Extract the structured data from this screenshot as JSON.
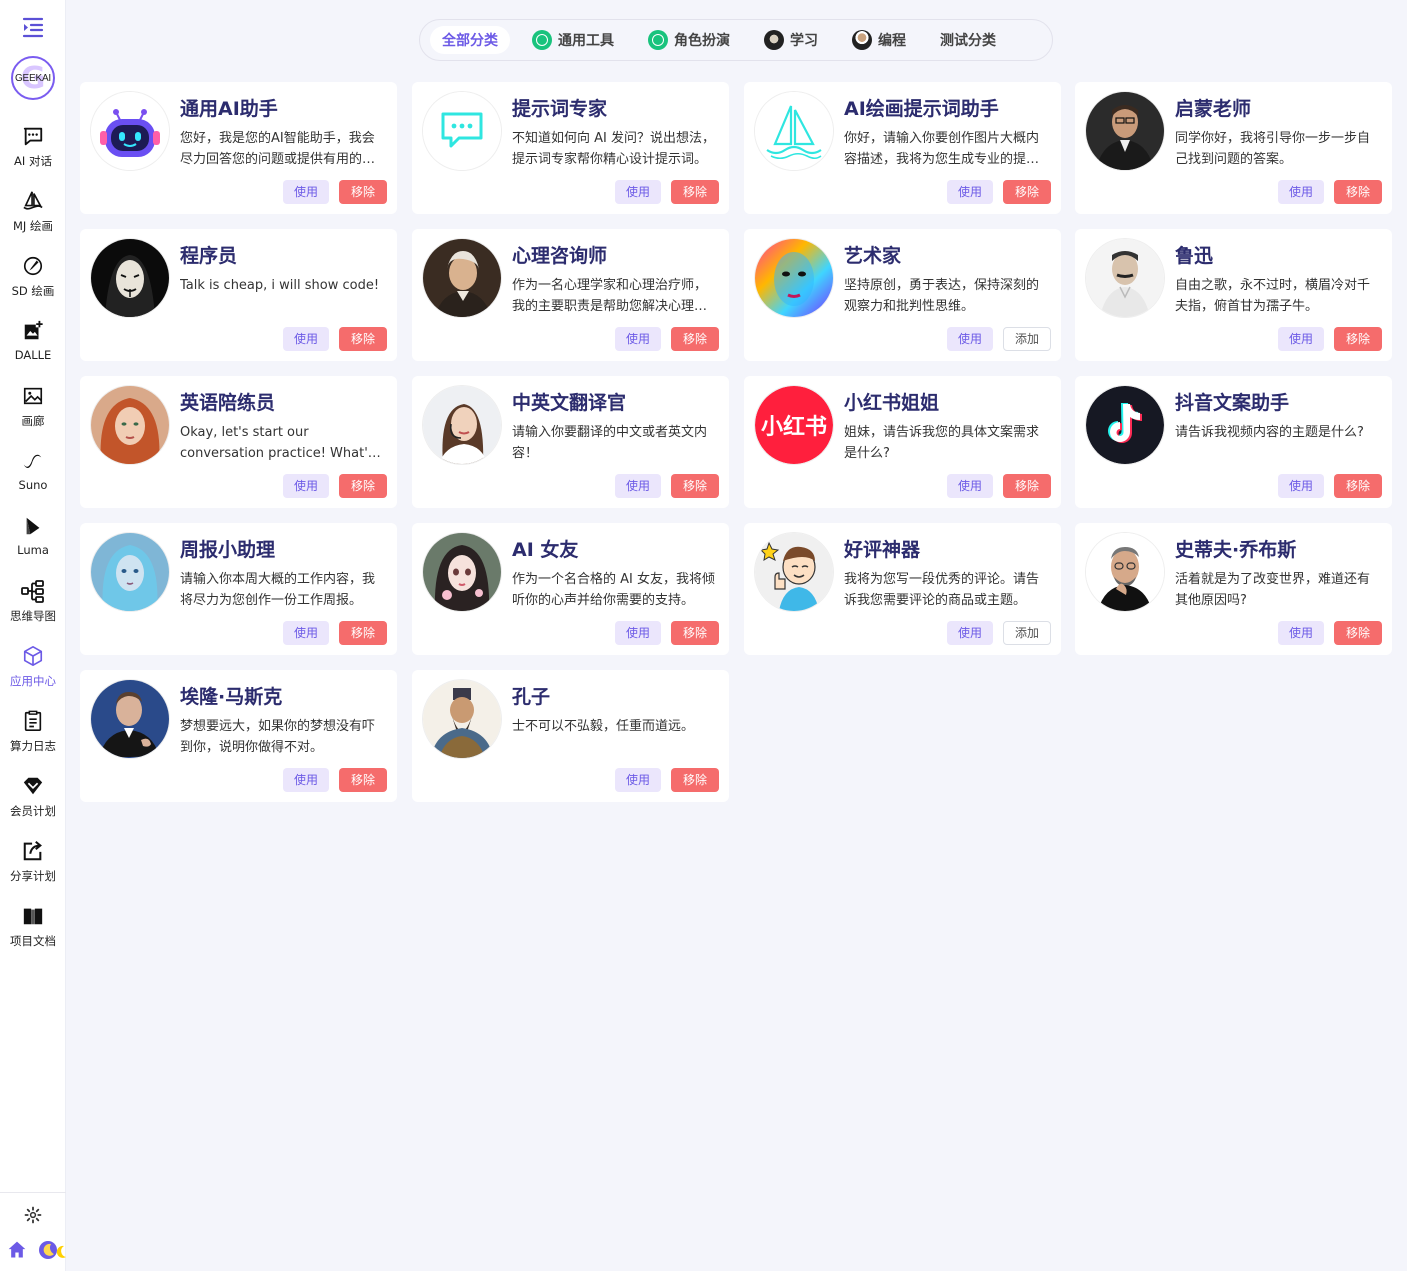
{
  "sidebar": {
    "logo_text": "GEEKAI",
    "items": [
      {
        "label": "AI 对话",
        "icon": "chat-icon"
      },
      {
        "label": "MJ 绘画",
        "icon": "sailboat-icon"
      },
      {
        "label": "SD 绘画",
        "icon": "palette-icon"
      },
      {
        "label": "DALLE",
        "icon": "image-plus-icon"
      },
      {
        "label": "画廊",
        "icon": "gallery-icon"
      },
      {
        "label": "Suno",
        "icon": "music-wave-icon"
      },
      {
        "label": "Luma",
        "icon": "luma-icon"
      },
      {
        "label": "思维导图",
        "icon": "mindmap-icon"
      },
      {
        "label": "应用中心",
        "icon": "cube-icon",
        "active": true
      },
      {
        "label": "算力日志",
        "icon": "log-icon"
      },
      {
        "label": "会员计划",
        "icon": "diamond-icon"
      },
      {
        "label": "分享计划",
        "icon": "share-icon"
      },
      {
        "label": "项目文档",
        "icon": "book-icon"
      }
    ]
  },
  "tabs": [
    {
      "label": "全部分类",
      "active": true
    },
    {
      "label": "通用工具",
      "icon": "gpt-logo-icon"
    },
    {
      "label": "角色扮演",
      "icon": "gpt-logo-icon"
    },
    {
      "label": "学习",
      "icon": "monk-avatar-icon"
    },
    {
      "label": "编程",
      "icon": "jobs-avatar-icon"
    },
    {
      "label": "测试分类"
    }
  ],
  "cards": [
    {
      "title": "通用AI助手",
      "desc": "您好，我是您的AI智能助手，我会尽力回答您的问题或提供有用的建议。",
      "use": "使用",
      "action": "移除",
      "avatar": "robot-avatar"
    },
    {
      "title": "提示词专家",
      "desc": "不知道如何向 AI 发问？说出想法，提示词专家帮你精心设计提示词。",
      "use": "使用",
      "action": "移除",
      "avatar": "chat-bubble-avatar"
    },
    {
      "title": "AI绘画提示词助手",
      "desc": "你好，请输入你要创作图片大概内容描述，我将为您生成专业的提示词。",
      "use": "使用",
      "action": "移除",
      "avatar": "sailboat-avatar"
    },
    {
      "title": "启蒙老师",
      "desc": "同学你好，我将引导你一步一步自己找到问题的答案。",
      "use": "使用",
      "action": "移除",
      "avatar": "teacher-avatar"
    },
    {
      "title": "程序员",
      "desc": "Talk is cheap, i will show code!",
      "use": "使用",
      "action": "移除",
      "avatar": "hacker-avatar"
    },
    {
      "title": "心理咨询师",
      "desc": "作为一名心理学家和心理治疗师，我的主要职责是帮助您解决心理问题。",
      "use": "使用",
      "action": "移除",
      "avatar": "philosopher-avatar"
    },
    {
      "title": "艺术家",
      "desc": "坚持原创，勇于表达，保持深刻的观察力和批判性思维。",
      "use": "使用",
      "action": "添加",
      "avatar": "painted-face-avatar"
    },
    {
      "title": "鲁迅",
      "desc": "自由之歌，永不过时，横眉冷对千夫指，俯首甘为孺子牛。",
      "use": "使用",
      "action": "移除",
      "avatar": "luxun-avatar"
    },
    {
      "title": "英语陪练员",
      "desc": "Okay, let's start our conversation practice! What's your name?",
      "use": "使用",
      "action": "移除",
      "avatar": "redhead-avatar"
    },
    {
      "title": "中英文翻译官",
      "desc": "请输入你要翻译的中文或者英文内容！",
      "use": "使用",
      "action": "移除",
      "avatar": "headset-woman-avatar"
    },
    {
      "title": "小红书姐姐",
      "desc": "姐妹，请告诉我您的具体文案需求是什么?",
      "use": "使用",
      "action": "移除",
      "avatar": "xiaohongshu-logo",
      "logo_text": "小红书"
    },
    {
      "title": "抖音文案助手",
      "desc": "请告诉我视频内容的主题是什么?",
      "use": "使用",
      "action": "移除",
      "avatar": "douyin-logo"
    },
    {
      "title": "周报小助理",
      "desc": "请输入你本周大概的工作内容，我将尽力为您创作一份工作周报。",
      "use": "使用",
      "action": "移除",
      "avatar": "blue-girl-avatar"
    },
    {
      "title": "AI 女友",
      "desc": "作为一个名合格的 AI 女友，我将倾听你的心声并给你需要的支持。",
      "use": "使用",
      "action": "移除",
      "avatar": "anime-girl-avatar"
    },
    {
      "title": "好评神器",
      "desc": "我将为您写一段优秀的评论。请告诉我您需要评论的商品或主题。",
      "use": "使用",
      "action": "添加",
      "avatar": "thumbs-up-boy-avatar"
    },
    {
      "title": "史蒂夫·乔布斯",
      "desc": "活着就是为了改变世界，难道还有其他原因吗?",
      "use": "使用",
      "action": "移除",
      "avatar": "jobs-avatar"
    },
    {
      "title": "埃隆·马斯克",
      "desc": "梦想要远大，如果你的梦想没有吓到你，说明你做得不对。",
      "use": "使用",
      "action": "移除",
      "avatar": "musk-avatar"
    },
    {
      "title": "孔子",
      "desc": "士不可以不弘毅，任重而道远。",
      "use": "使用",
      "action": "移除",
      "avatar": "confucius-avatar"
    }
  ]
}
